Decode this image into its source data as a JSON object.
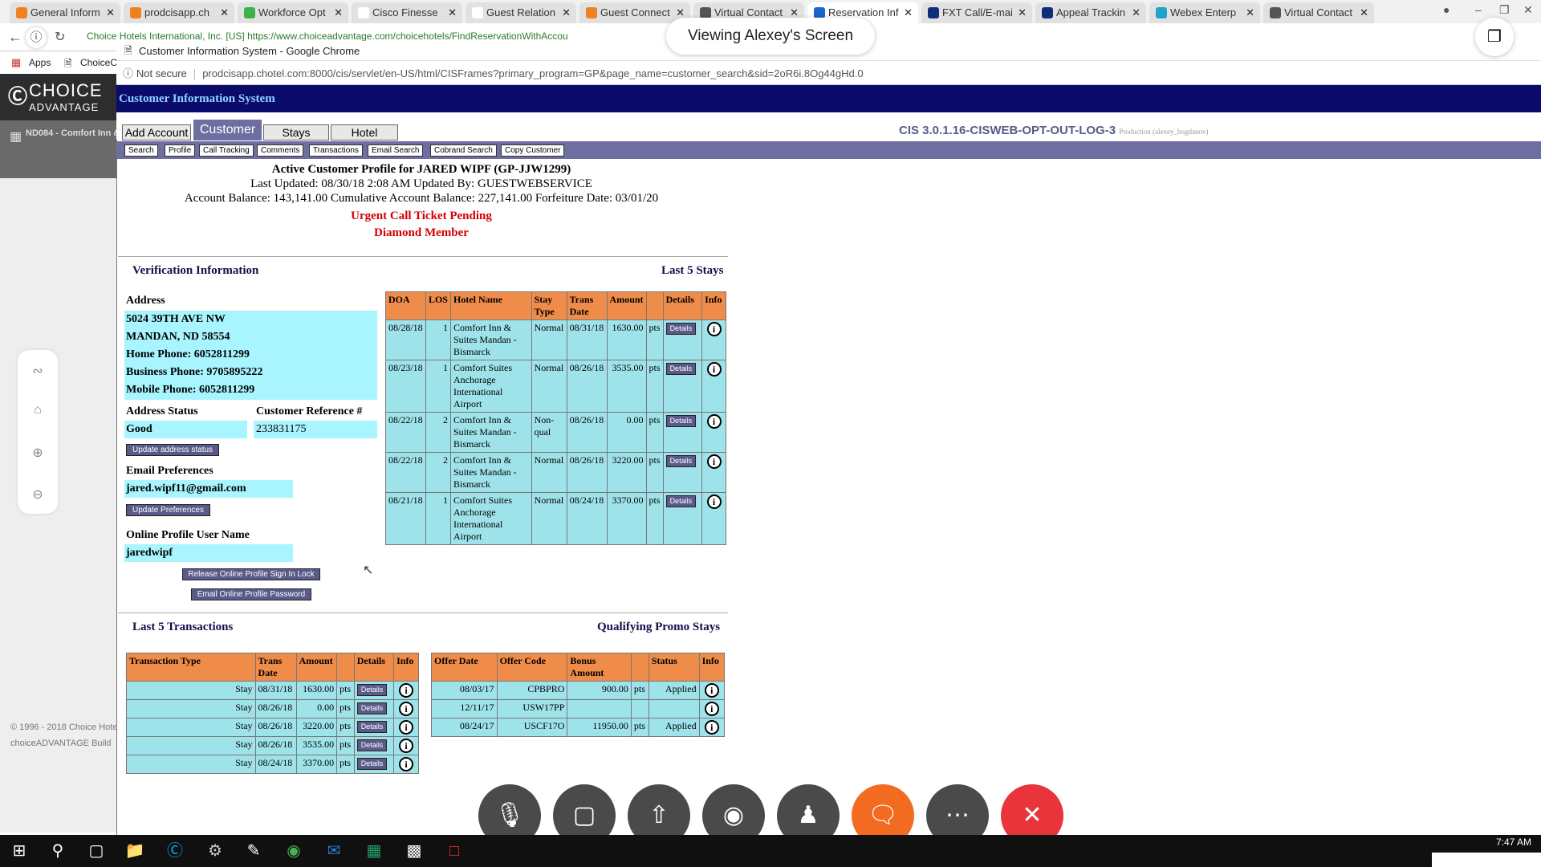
{
  "browser_tabs": [
    {
      "label": "General Inform",
      "color": "#f08020"
    },
    {
      "label": "prodcisapp.ch",
      "color": "#f08020"
    },
    {
      "label": "Workforce Opt",
      "color": "#3cb34a"
    },
    {
      "label": "Cisco Finesse",
      "color": "#ffffff"
    },
    {
      "label": "Guest Relation",
      "color": "#ffffff"
    },
    {
      "label": "Guest Connect",
      "color": "#f08020"
    },
    {
      "label": "Virtual Contact",
      "color": "#555555"
    },
    {
      "label": "Reservation Inf",
      "color": "#1a66cc"
    },
    {
      "label": "FXT Call/E-mai",
      "color": "#0b2f7a"
    },
    {
      "label": "Appeal Trackin",
      "color": "#0b2f7a"
    },
    {
      "label": "Webex Enterp",
      "color": "#1fa3c9"
    },
    {
      "label": "Virtual Contact",
      "color": "#555555"
    }
  ],
  "outer_url": "Choice Hotels International, Inc. [US]  https://www.choiceadvantage.com/choicehotels/FindReservationWithAccou",
  "bookmarks": {
    "apps": "Apps",
    "choice": "ChoiceC"
  },
  "choice_advantage": {
    "logo_line1": "CHOICE",
    "logo_line2": "ADVANTAGE",
    "property": "ND084 - Comfort Inn &",
    "footer1": "© 1996 - 2018 Choice Hote",
    "footer2": "choiceADVANTAGE Build"
  },
  "overlay": {
    "viewing": "Viewing Alexey's Screen"
  },
  "inner": {
    "title": "Customer Information System - Google Chrome",
    "not_secure": "Not secure",
    "url": "prodcisapp.chotel.com:8000/cis/servlet/en-US/html/CISFrames?primary_program=GP&page_name=customer_search&sid=2oR6i.8Og44gHd.0",
    "app_title": "Customer Information System",
    "tabs": [
      "Add Account",
      "Customer",
      "Stays",
      "Hotel"
    ],
    "version": "CIS 3.0.1.16-CISWEB-OPT-OUT-LOG-3",
    "version_env": "Production (alexey_bogdanov)",
    "subnav": [
      "Search",
      "Profile",
      "Call Tracking",
      "Comments",
      "Transactions",
      "Email Search",
      "Cobrand Search",
      "Copy Customer"
    ]
  },
  "profile": {
    "title": "Active  Customer Profile for  JARED WIPF   (GP-JJW1299)",
    "updated": "Last Updated:  08/30/18 2:08 AM  Updated By:  GUESTWEBSERVICE",
    "balance": "Account Balance:  143,141.00    Cumulative Account Balance:  227,141.00    Forfeiture Date:  03/01/20",
    "alert": "Urgent Call Ticket Pending",
    "tier": "Diamond  Member"
  },
  "verification": {
    "heading": "Verification Information",
    "address_label": "Address",
    "address_lines": [
      "5024 39TH AVE NW",
      "MANDAN,  ND  58554",
      "Home Phone:  6052811299",
      "Business Phone:  9705895222",
      "Mobile Phone:  6052811299"
    ],
    "address_status_label": "Address Status",
    "address_status": "Good",
    "custref_label": "Customer Reference #",
    "custref": "233831175",
    "update_address_btn": "Update address status",
    "email_pref_label": "Email Preferences",
    "email": "jared.wipf11@gmail.com",
    "update_pref_btn": "Update Preferences",
    "online_label": "Online Profile User Name",
    "username": "jaredwipf",
    "release_btn": "Release Online Profile Sign In Lock",
    "email_pw_btn": "Email Online Profile Password"
  },
  "last5stays": {
    "heading": "Last 5 Stays",
    "columns": [
      "DOA",
      "LOS",
      "Hotel Name",
      "Stay Type",
      "Trans Date",
      "Amount",
      "",
      "Details",
      "Info"
    ],
    "rows": [
      {
        "doa": "08/28/18",
        "los": "1",
        "hotel": "Comfort Inn & Suites Mandan - Bismarck",
        "type": "Normal",
        "trans": "08/31/18",
        "amount": "1630.00",
        "unit": "pts"
      },
      {
        "doa": "08/23/18",
        "los": "1",
        "hotel": "Comfort Suites Anchorage International Airport",
        "type": "Normal",
        "trans": "08/26/18",
        "amount": "3535.00",
        "unit": "pts"
      },
      {
        "doa": "08/22/18",
        "los": "2",
        "hotel": "Comfort Inn & Suites Mandan - Bismarck",
        "type": "Non-qual",
        "trans": "08/26/18",
        "amount": "0.00",
        "unit": "pts"
      },
      {
        "doa": "08/22/18",
        "los": "2",
        "hotel": "Comfort Inn & Suites Mandan - Bismarck",
        "type": "Normal",
        "trans": "08/26/18",
        "amount": "3220.00",
        "unit": "pts"
      },
      {
        "doa": "08/21/18",
        "los": "1",
        "hotel": "Comfort Suites Anchorage International Airport",
        "type": "Normal",
        "trans": "08/24/18",
        "amount": "3370.00",
        "unit": "pts"
      }
    ],
    "details_label": "Details"
  },
  "transactions": {
    "heading": "Last 5 Transactions",
    "columns": [
      "Transaction Type",
      "Trans Date",
      "Amount",
      "",
      "Details",
      "Info"
    ],
    "rows": [
      {
        "type": "Stay",
        "date": "08/31/18",
        "amount": "1630.00",
        "unit": "pts"
      },
      {
        "type": "Stay",
        "date": "08/26/18",
        "amount": "0.00",
        "unit": "pts"
      },
      {
        "type": "Stay",
        "date": "08/26/18",
        "amount": "3220.00",
        "unit": "pts"
      },
      {
        "type": "Stay",
        "date": "08/26/18",
        "amount": "3535.00",
        "unit": "pts"
      },
      {
        "type": "Stay",
        "date": "08/24/18",
        "amount": "3370.00",
        "unit": "pts"
      }
    ]
  },
  "promo": {
    "heading": "Qualifying Promo Stays",
    "columns": [
      "Offer Date",
      "Offer Code",
      "Bonus Amount",
      "",
      "Status",
      "Info"
    ],
    "rows": [
      {
        "date": "08/03/17",
        "code": "CPBPRO",
        "bonus": "900.00",
        "unit": "pts",
        "status": "Applied"
      },
      {
        "date": "12/11/17",
        "code": "USW17PP",
        "bonus": "",
        "unit": "",
        "status": ""
      },
      {
        "date": "08/24/17",
        "code": "USCF17O",
        "bonus": "11950.00",
        "unit": "pts",
        "status": "Applied"
      }
    ]
  },
  "taskbar": {
    "clock": "7:47 AM"
  }
}
